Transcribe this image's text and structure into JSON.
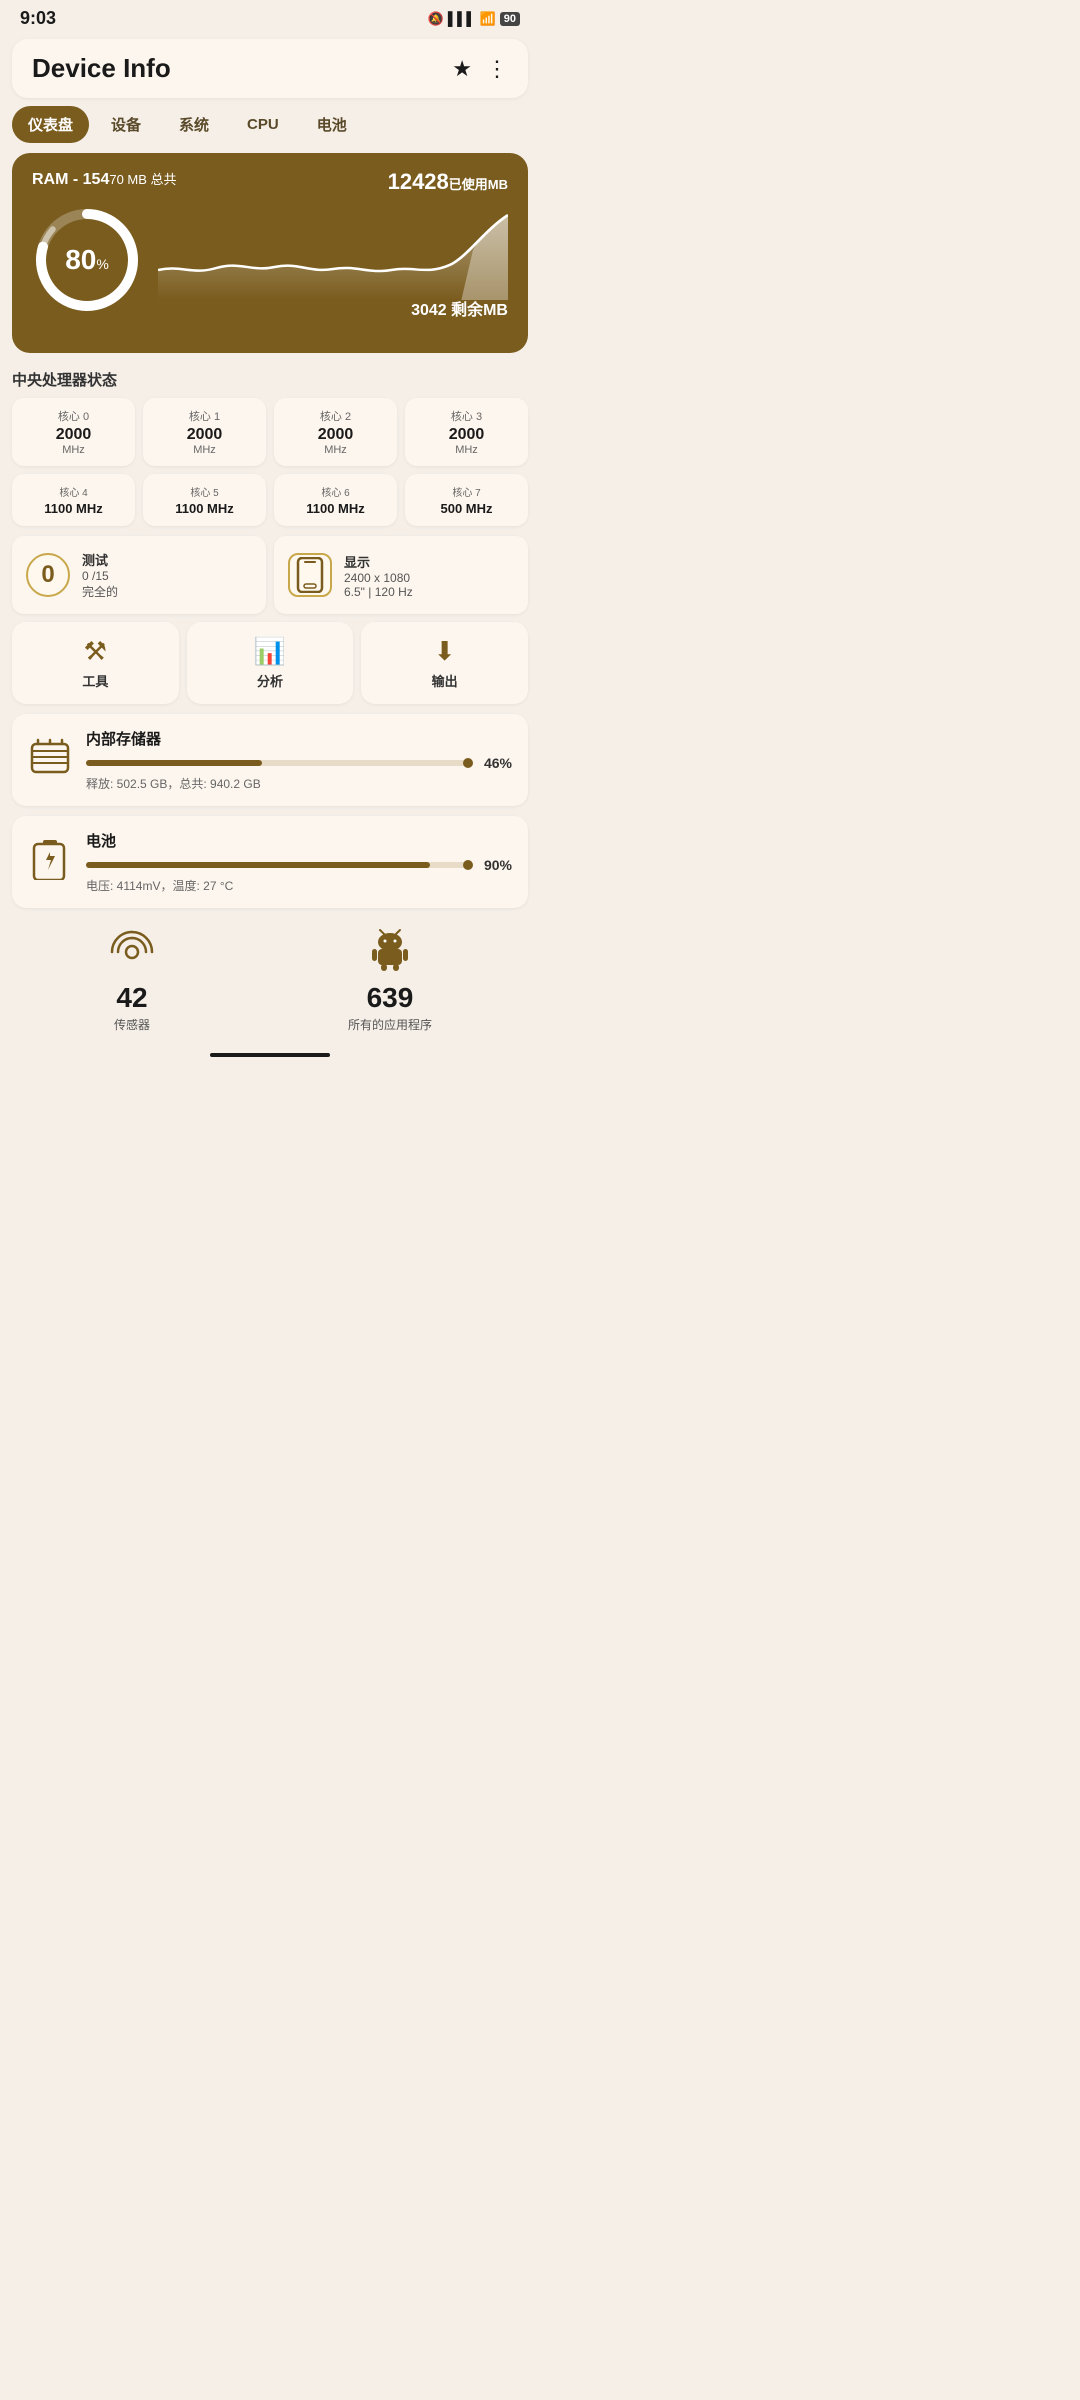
{
  "status": {
    "time": "9:03",
    "battery": "90"
  },
  "header": {
    "title": "Device Info"
  },
  "tabs": [
    {
      "label": "仪表盘",
      "active": true
    },
    {
      "label": "设备",
      "active": false
    },
    {
      "label": "系统",
      "active": false
    },
    {
      "label": "CPU",
      "active": false
    },
    {
      "label": "电池",
      "active": false
    }
  ],
  "ram": {
    "title": "RAM - 154",
    "title_unit": "70 MB 总共",
    "used": "12428",
    "used_label": "已使用MB",
    "percent": 80,
    "remaining": "3042 剩余MB"
  },
  "cpu_section_title": "中央处理器状态",
  "cpu_cores_row1": [
    {
      "label": "核心 0",
      "mhz": "2000",
      "unit": "MHz"
    },
    {
      "label": "核心 1",
      "mhz": "2000",
      "unit": "MHz"
    },
    {
      "label": "核心 2",
      "mhz": "2000",
      "unit": "MHz"
    },
    {
      "label": "核心 3",
      "mhz": "2000",
      "unit": "MHz"
    }
  ],
  "cpu_cores_row2": [
    {
      "label": "核心 4",
      "mhz": "1100 MHz"
    },
    {
      "label": "核心 5",
      "mhz": "1100 MHz"
    },
    {
      "label": "核心 6",
      "mhz": "1100 MHz"
    },
    {
      "label": "核心 7",
      "mhz": "500 MHz"
    }
  ],
  "info_cards": [
    {
      "icon": "⓪",
      "title": "测试",
      "sub1": "0 /15",
      "sub2": "完全的"
    },
    {
      "icon": "📱",
      "title": "显示",
      "sub1": "2400 x 1080",
      "sub2": "6.5\" | 120 Hz"
    }
  ],
  "tools": [
    {
      "label": "工具"
    },
    {
      "label": "分析"
    },
    {
      "label": "输出"
    }
  ],
  "storage": {
    "title": "内部存储器",
    "percent": 46,
    "sub": "释放: 502.5 GB，总共: 940.2 GB"
  },
  "battery": {
    "title": "电池",
    "percent": 90,
    "sub": "电压: 4114mV，温度: 27 °C"
  },
  "bottom_stats": [
    {
      "number": "42",
      "label": "传感器"
    },
    {
      "number": "639",
      "label": "所有的应用程序"
    }
  ]
}
